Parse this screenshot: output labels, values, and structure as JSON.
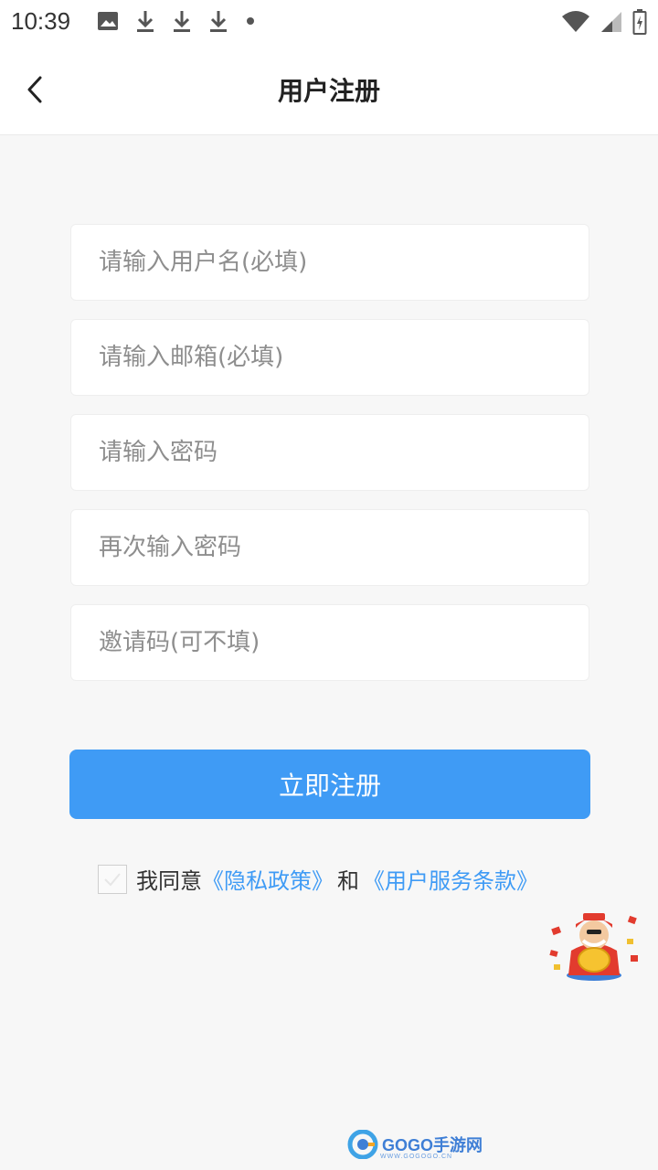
{
  "status_bar": {
    "time": "10:39",
    "left_icons": [
      "image-icon",
      "download-icon",
      "download-icon",
      "download-icon",
      "dot-icon"
    ],
    "right_icons": [
      "wifi-icon",
      "signal-icon",
      "battery-icon"
    ]
  },
  "header": {
    "title": "用户注册",
    "back_icon": "chevron-left-icon"
  },
  "form": {
    "fields": [
      {
        "placeholder": "请输入用户名(必填)",
        "value": ""
      },
      {
        "placeholder": "请输入邮箱(必填)",
        "value": ""
      },
      {
        "placeholder": "请输入密码",
        "value": ""
      },
      {
        "placeholder": "再次输入密码",
        "value": ""
      },
      {
        "placeholder": "邀请码(可不填)",
        "value": ""
      }
    ],
    "submit_label": "立即注册"
  },
  "agreement": {
    "checked": false,
    "prefix": "我同意",
    "privacy_link": "《隐私政策》",
    "conjunction": "和",
    "terms_link": "《用户服务条款》"
  },
  "watermark": {
    "brand": "GOGO手游网",
    "url": "WWW.GOGOGO.CN"
  },
  "colors": {
    "accent": "#3f9bf5",
    "background": "#f7f7f7"
  }
}
